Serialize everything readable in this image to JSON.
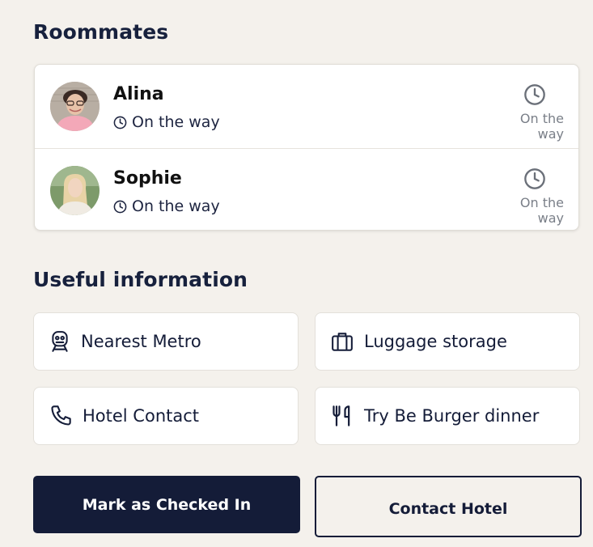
{
  "roommates": {
    "title": "Roommates",
    "items": [
      {
        "name": "Alina",
        "status": "On the way",
        "side_status": "On the way"
      },
      {
        "name": "Sophie",
        "status": "On the way",
        "side_status": "On the way"
      }
    ]
  },
  "useful_info": {
    "title": "Useful information",
    "items": [
      {
        "label": "Nearest Metro",
        "icon": "metro-icon"
      },
      {
        "label": "Luggage storage",
        "icon": "luggage-icon"
      },
      {
        "label": "Hotel Contact",
        "icon": "phone-icon"
      },
      {
        "label": "Try Be Burger dinner",
        "icon": "fork-knife-icon"
      }
    ]
  },
  "actions": {
    "check_in_label": "Mark as Checked In",
    "contact_label": "Contact Hotel"
  },
  "colors": {
    "background": "#f4f1ec",
    "primary": "#141c38",
    "muted": "#7a7f88"
  }
}
